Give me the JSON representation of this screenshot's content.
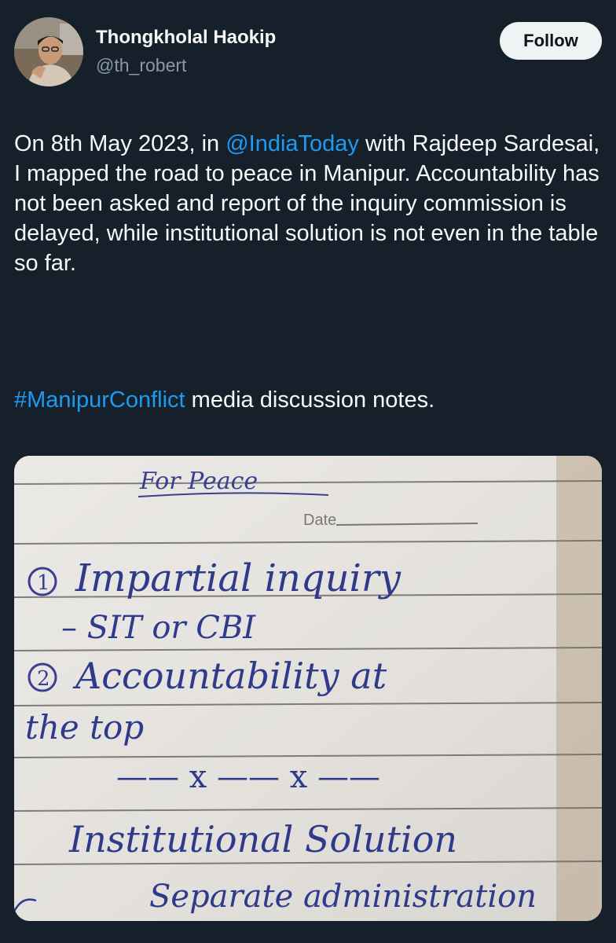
{
  "author": {
    "name": "Thongkholal Haokip",
    "handle": "@th_robert",
    "avatar_icon": "profile-photo"
  },
  "follow_button": {
    "label": "Follow"
  },
  "tweet": {
    "text_before_mention": "On 8th May 2023, in ",
    "mention": "@IndiaToday",
    "text_after_mention": " with Rajdeep Sardesai, I mapped the road to peace in Manipur. Accountability has not been asked and report of the inquiry commission is delayed, while institutional solution is not even in the table so far.",
    "hashtag": "#ManipurConflict",
    "hashtag_suffix": " media discussion notes."
  },
  "media": {
    "type": "handwritten-note-photo",
    "notes": {
      "heading": "For Peace",
      "date_label": "Date",
      "item1_number": "1",
      "item1_text": "Impartial inquiry",
      "item1_sub": "– SIT or CBI",
      "item2_number": "2",
      "item2_text": "Accountability at",
      "item2_text_cont": "the top",
      "divider": "—— x —— x ——",
      "item3_text": "Institutional Solution",
      "item3_sub": "Separate administration"
    }
  },
  "colors": {
    "background": "#15202b",
    "text": "#f7f9f9",
    "secondary": "#8b98a5",
    "link": "#1d9bf0",
    "ink": "#2f3a8a"
  }
}
